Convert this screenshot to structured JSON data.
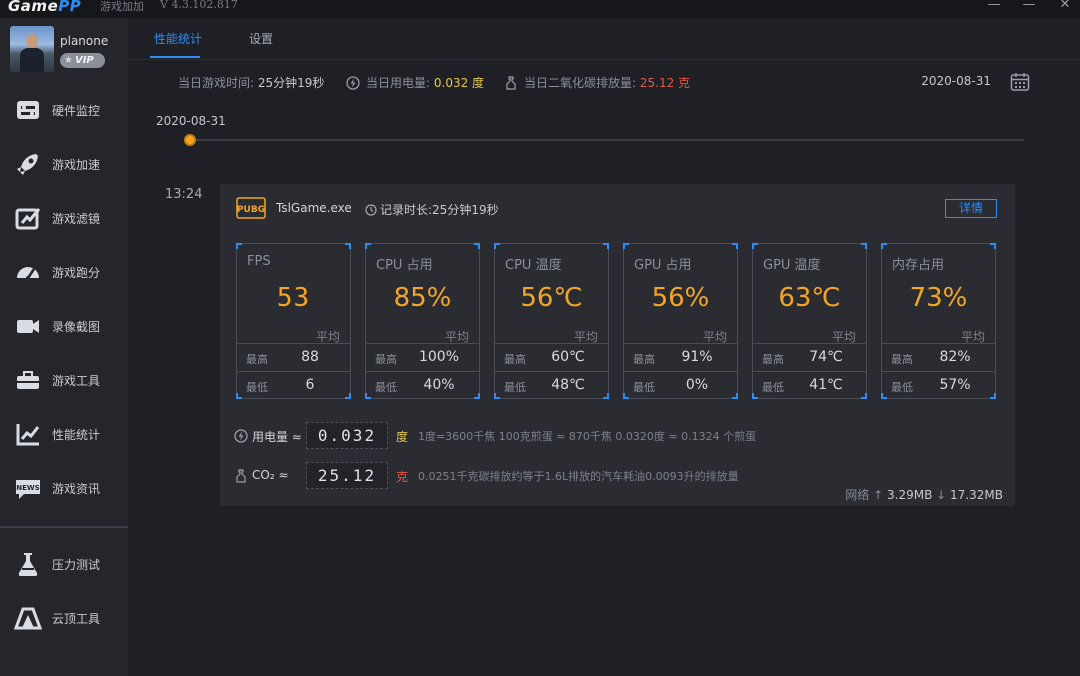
{
  "titlebar": {
    "logo_main": "Game",
    "logo_accent": "PP",
    "app_name": "游戏加加",
    "version": "V 4.3.102.817",
    "minimize": "—",
    "maximize": "—",
    "close": "✕"
  },
  "user": {
    "name": "planone",
    "vip_label": "VIP"
  },
  "sidebar": {
    "items": [
      {
        "label": "硬件监控",
        "icon": "hardware-monitor-icon"
      },
      {
        "label": "游戏加速",
        "icon": "rocket-icon"
      },
      {
        "label": "游戏滤镜",
        "icon": "filter-icon"
      },
      {
        "label": "游戏跑分",
        "icon": "speedometer-icon"
      },
      {
        "label": "录像截图",
        "icon": "video-camera-icon"
      },
      {
        "label": "游戏工具",
        "icon": "toolbox-icon"
      },
      {
        "label": "性能统计",
        "icon": "chart-icon"
      },
      {
        "label": "游戏资讯",
        "icon": "news-icon"
      },
      {
        "label": "压力测试",
        "icon": "flask-icon"
      },
      {
        "label": "云顶工具",
        "icon": "cloud-tool-icon"
      }
    ]
  },
  "tabs": [
    {
      "label": "性能统计",
      "active": true
    },
    {
      "label": "设置",
      "active": false
    }
  ],
  "stats": {
    "play_time_label": "当日游戏时间:",
    "play_time_value": "25分钟19秒",
    "power_label": "当日用电量:",
    "power_value": "0.032 度",
    "co2_label": "当日二氧化碳排放量:",
    "co2_value": "25.12 克"
  },
  "date_selected": "2020-08-31",
  "timeline": {
    "date": "2020-08-31"
  },
  "session": {
    "time": "13:24",
    "exe": "TslGame.exe",
    "duration": "记录时长:25分钟19秒",
    "detail_button": "详情",
    "avg_label": "平均",
    "max_label": "最高",
    "min_label": "最低",
    "metrics": [
      {
        "label": "FPS",
        "avg": "53",
        "max": "88",
        "min": "6"
      },
      {
        "label": "CPU 占用",
        "avg": "85%",
        "max": "100%",
        "min": "40%"
      },
      {
        "label": "CPU 温度",
        "avg": "56℃",
        "max": "60℃",
        "min": "48℃"
      },
      {
        "label": "GPU 占用",
        "avg": "56%",
        "max": "91%",
        "min": "0%"
      },
      {
        "label": "GPU 温度",
        "avg": "63℃",
        "max": "74℃",
        "min": "41℃"
      },
      {
        "label": "内存占用",
        "avg": "73%",
        "max": "82%",
        "min": "57%"
      }
    ],
    "power": {
      "label": "用电量 ≈",
      "value": "0.032",
      "unit": "度",
      "desc": "1度=3600千焦    100克煎蛋 ≈ 870千焦    0.0320度 ≈ 0.1324 个煎蛋"
    },
    "co2": {
      "label": "CO₂ ≈",
      "value": "25.12",
      "unit": "克",
      "desc": "0.0251千克碳排放约等于1.6L排放的汽车耗油0.0093升的排放量"
    },
    "network": {
      "label": "网络",
      "up": "3.29MB",
      "down": "17.32MB"
    }
  },
  "colors": {
    "accent": "#2c8df4",
    "value_orange": "#f3a623",
    "power_yellow": "#e6c84a",
    "co2_red": "#e55a45"
  }
}
